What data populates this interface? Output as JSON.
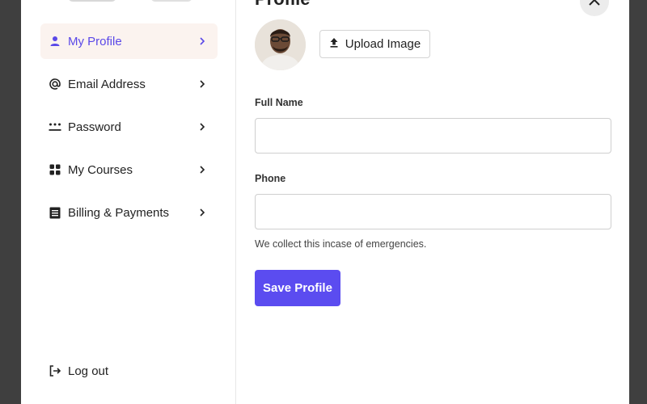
{
  "sidebar": {
    "items": [
      {
        "label": "My Profile",
        "icon": "user-icon",
        "active": true
      },
      {
        "label": "Email Address",
        "icon": "at-icon",
        "active": false
      },
      {
        "label": "Password",
        "icon": "password-dots-icon",
        "active": false
      },
      {
        "label": "My Courses",
        "icon": "grid-icon",
        "active": false
      },
      {
        "label": "Billing & Payments",
        "icon": "receipt-icon",
        "active": false
      }
    ],
    "logout_label": "Log out"
  },
  "main": {
    "title": "Profile",
    "upload_label": "Upload Image",
    "full_name": {
      "label": "Full Name",
      "value": "",
      "placeholder": ""
    },
    "phone": {
      "label": "Phone",
      "value": "",
      "placeholder": ""
    },
    "phone_hint": "We collect this incase of emergencies.",
    "save_label": "Save Profile"
  },
  "colors": {
    "accent": "#5b4cf0",
    "active_bg": "#fbf3ef",
    "backdrop": "#3f3f3f"
  }
}
